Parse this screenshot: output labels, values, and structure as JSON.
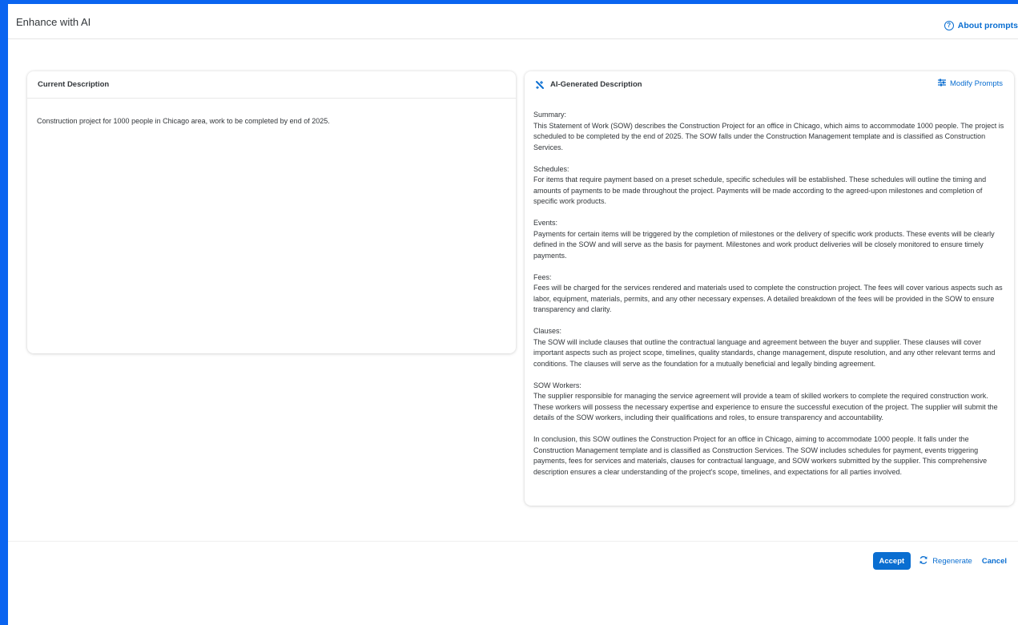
{
  "dialog": {
    "title": "Enhance with AI"
  },
  "header": {
    "about_label": "About prompts"
  },
  "current": {
    "title": "Current Description",
    "text": "Construction project for 1000 people in Chicago area, work to be completed by end of 2025."
  },
  "generated": {
    "title": "AI-Generated Description",
    "modify_label": "Modify Prompts",
    "sections": [
      {
        "label": "Summary:",
        "text": "This Statement of Work (SOW) describes the Construction Project for an office in Chicago, which aims to accommodate 1000 people. The project is scheduled to be completed by the end of 2025. The SOW falls under the Construction Management template and is classified as Construction Services."
      },
      {
        "label": "Schedules:",
        "text": "For items that require payment based on a preset schedule, specific schedules will be established. These schedules will outline the timing and amounts of payments to be made throughout the project. Payments will be made according to the agreed-upon milestones and completion of specific work products."
      },
      {
        "label": "Events:",
        "text": "Payments for certain items will be triggered by the completion of milestones or the delivery of specific work products. These events will be clearly defined in the SOW and will serve as the basis for payment. Milestones and work product deliveries will be closely monitored to ensure timely payments."
      },
      {
        "label": "Fees:",
        "text": "Fees will be charged for the services rendered and materials used to complete the construction project. The fees will cover various aspects such as labor, equipment, materials, permits, and any other necessary expenses. A detailed breakdown of the fees will be provided in the SOW to ensure transparency and clarity."
      },
      {
        "label": "Clauses:",
        "text": "The SOW will include clauses that outline the contractual language and agreement between the buyer and supplier. These clauses will cover important aspects such as project scope, timelines, quality standards, change management, dispute resolution, and any other relevant terms and conditions. The clauses will serve as the foundation for a mutually beneficial and legally binding agreement."
      },
      {
        "label": "SOW Workers:",
        "text": "The supplier responsible for managing the service agreement will provide a team of skilled workers to complete the required construction work. These workers will possess the necessary expertise and experience to ensure the successful execution of the project. The supplier will submit the details of the SOW workers, including their qualifications and roles, to ensure transparency and accountability."
      }
    ],
    "conclusion": "In conclusion, this SOW outlines the Construction Project for an office in Chicago, aiming to accommodate 1000 people. It falls under the Construction Management template and is classified as Construction Services. The SOW includes schedules for payment, events triggering payments, fees for services and materials, clauses for contractual language, and SOW workers submitted by the supplier. This comprehensive description ensures a clear understanding of the project's scope, timelines, and expectations for all parties involved."
  },
  "footer": {
    "accept": "Accept",
    "regenerate": "Regenerate",
    "cancel": "Cancel"
  },
  "icons": {
    "about": "help-circle-icon",
    "ai": "ai-sparkle-icon",
    "modify": "settings-sliders-icon",
    "regenerate": "refresh-icon"
  },
  "colors": {
    "background": "#0a64f0",
    "accent": "#0a6ed1",
    "text": "#32363a"
  }
}
